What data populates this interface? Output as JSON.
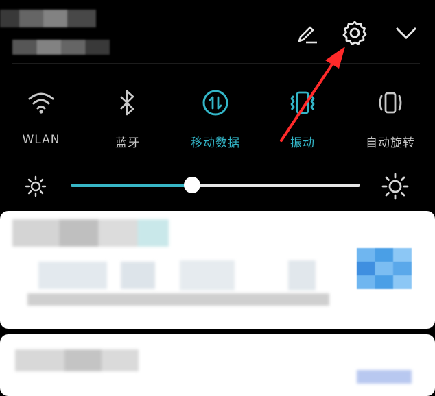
{
  "quick_settings": {
    "tiles": [
      {
        "label": "WLAN",
        "icon": "wifi-icon",
        "active": false
      },
      {
        "label": "蓝牙",
        "icon": "bluetooth-icon",
        "active": false
      },
      {
        "label": "移动数据",
        "icon": "mobile-data-icon",
        "active": true
      },
      {
        "label": "振动",
        "icon": "vibrate-icon",
        "active": true
      },
      {
        "label": "自动旋转",
        "icon": "auto-rotate-icon",
        "active": false
      }
    ],
    "toolbar_icons": [
      "edit-icon",
      "settings-icon",
      "chevron-down-icon"
    ]
  },
  "brightness": {
    "level_fraction": 0.42
  },
  "colors": {
    "background": "#000000",
    "accent": "#33b6c8",
    "inactive_text": "#c8c8c8",
    "annotation": "#ff2a2a",
    "card": "#ffffff"
  }
}
